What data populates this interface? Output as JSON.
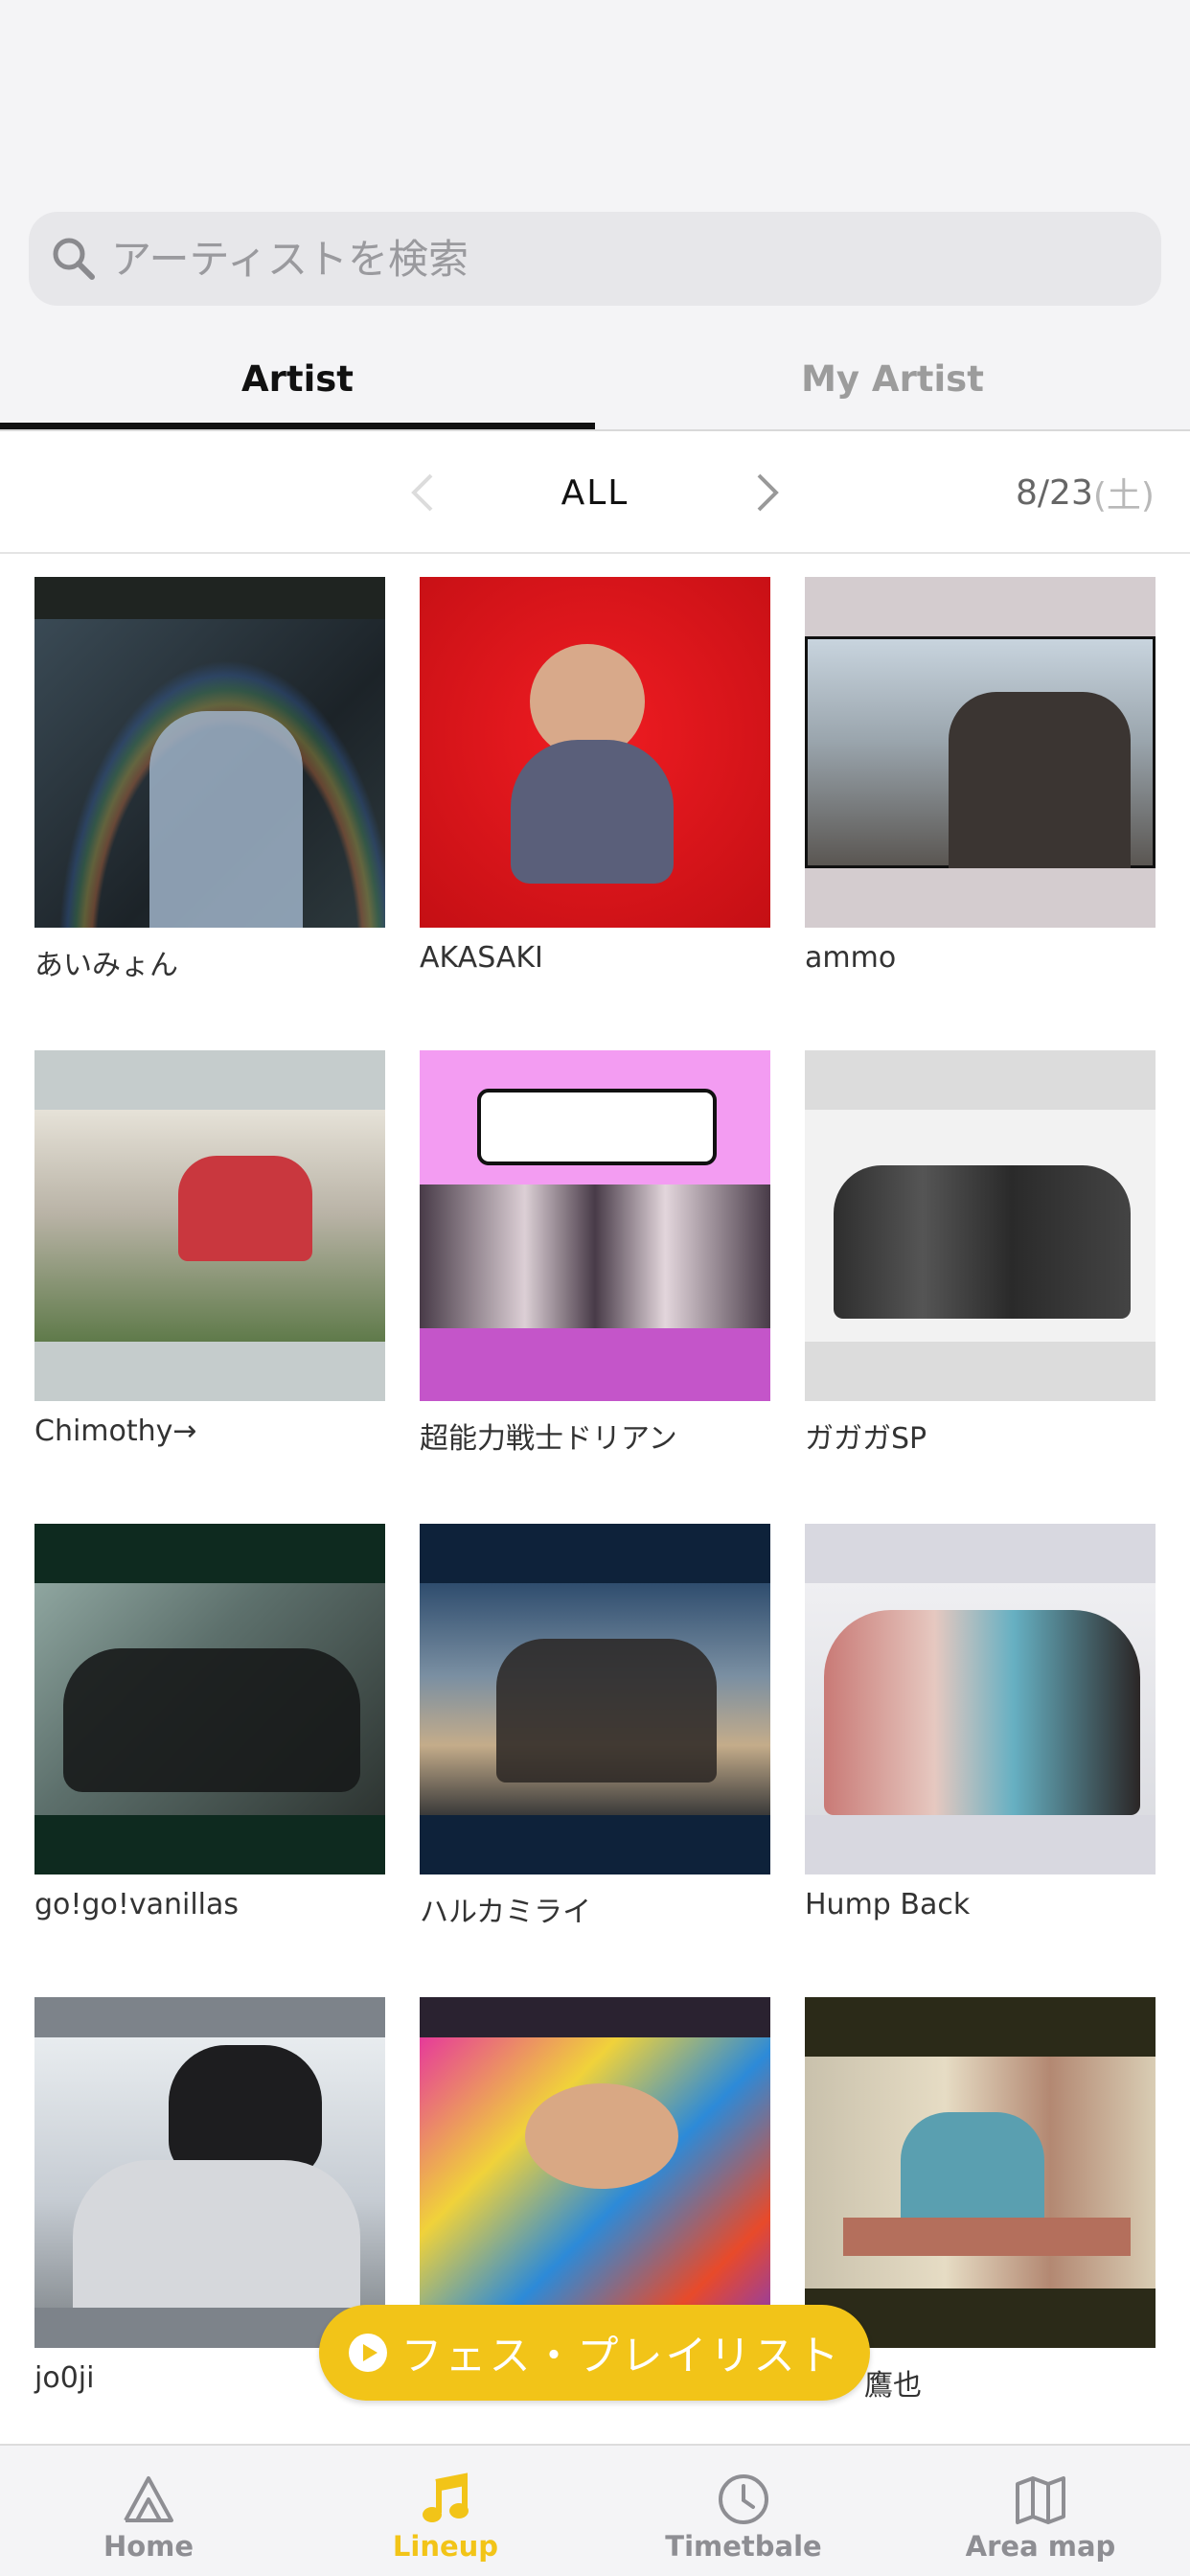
{
  "search": {
    "placeholder": "アーティストを検索",
    "value": ""
  },
  "tabs": [
    {
      "label": "Artist",
      "active": true
    },
    {
      "label": "My Artist",
      "active": false
    }
  ],
  "filter": {
    "label": "ALL",
    "date": "8/23",
    "date_suffix": "(土)"
  },
  "artists": [
    {
      "name": "あいみょん"
    },
    {
      "name": "AKASAKI"
    },
    {
      "name": "ammo"
    },
    {
      "name": "Chimothy→"
    },
    {
      "name": "超能力戦士ドリアン"
    },
    {
      "name": "ガガガSP"
    },
    {
      "name": "go!go!vanillas"
    },
    {
      "name": "ハルカミライ"
    },
    {
      "name": "Hump Back"
    },
    {
      "name": "jo0ji"
    },
    {
      "name": ""
    },
    {
      "name": "鷹也"
    }
  ],
  "playlist_button": {
    "label": "フェス・プレイリスト"
  },
  "tabbar": [
    {
      "label": "Home",
      "icon": "home-icon",
      "active": false
    },
    {
      "label": "Lineup",
      "icon": "music-note-icon",
      "active": true
    },
    {
      "label": "Timetbale",
      "icon": "clock-icon",
      "active": false
    },
    {
      "label": "Area map",
      "icon": "map-icon",
      "active": false
    }
  ],
  "colors": {
    "accent": "#f2c418",
    "inactive": "#8e8e93",
    "background": "#f4f4f6"
  }
}
